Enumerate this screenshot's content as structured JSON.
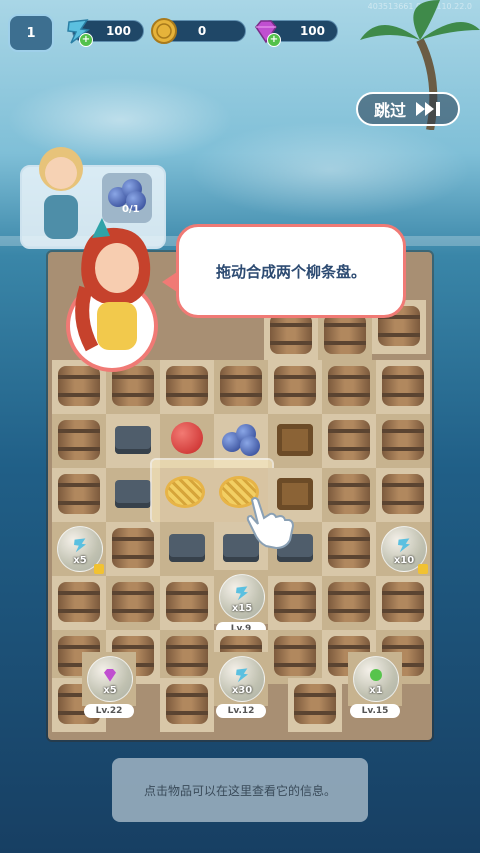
{
  "top_bar": {
    "level": "1",
    "energy": "100",
    "coins": "0",
    "gems": "100"
  },
  "skip_label": "跳过",
  "watermark": "403513661 0.21.110.22.0",
  "order": {
    "progress": "0/1"
  },
  "tutorial": {
    "message": "拖动合成两个柳条盘。"
  },
  "board_labels": {
    "bubble_1_count": "x5",
    "bubble_2_count": "x10",
    "bubble_3_count": "x15",
    "bubble_3_level": "Lv.9",
    "bubble_4_count": "x5",
    "bubble_4_level": "Lv.22",
    "bubble_5_count": "x30",
    "bubble_5_level": "Lv.12",
    "bubble_6_count": "x1",
    "bubble_6_level": "Lv.15"
  },
  "info_text": "点击物品可以在这里查看它的信息。",
  "colors": {
    "accent": "#f07a75",
    "text_dark": "#2d4b72",
    "board": "#a88f73"
  }
}
